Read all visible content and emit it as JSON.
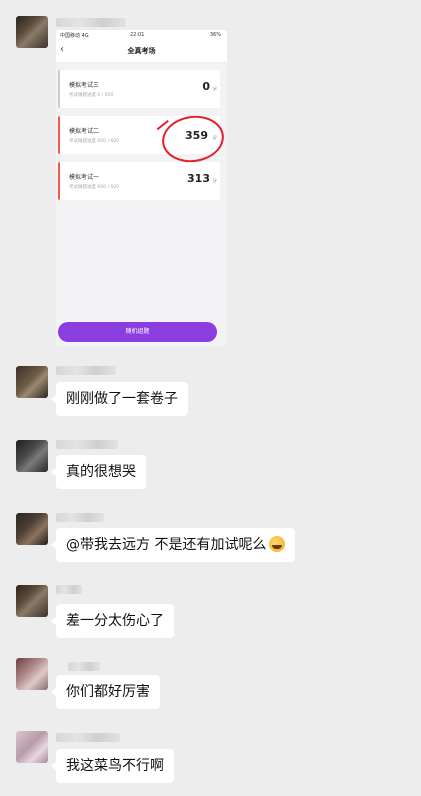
{
  "screenshot": {
    "status_bar": {
      "carrier": "中国移动 4G",
      "time": "22:01",
      "battery": "36%"
    },
    "nav_title": "全真考场",
    "cards": [
      {
        "name": "模拟考试三",
        "progress": "考试做题进度 0 / 600",
        "score": "0",
        "unit": "分"
      },
      {
        "name": "模拟考试二",
        "progress": "考试做题进度 600 / 600",
        "score": "359",
        "unit": "分"
      },
      {
        "name": "模拟考试一",
        "progress": "考试做题进度 600 / 600",
        "score": "313",
        "unit": "分"
      }
    ],
    "button": "随机组题"
  },
  "messages": [
    {
      "text": "刚刚做了一套卷子"
    },
    {
      "text": "真的很想哭"
    },
    {
      "text": "@带我去远方 不是还有加试呢么"
    },
    {
      "text": "差一分太伤心了"
    },
    {
      "text": "你们都好厉害"
    },
    {
      "text": "我这菜鸟不行啊"
    }
  ],
  "colors": {
    "chat_bg": "#ededed",
    "bubble": "#ffffff",
    "accent_purple": "#8a3ee0",
    "card_red": "#f25a4a",
    "annotation_red": "#e6202a"
  },
  "icons": [
    "back-arrow-icon",
    "grin-emoji-icon"
  ]
}
